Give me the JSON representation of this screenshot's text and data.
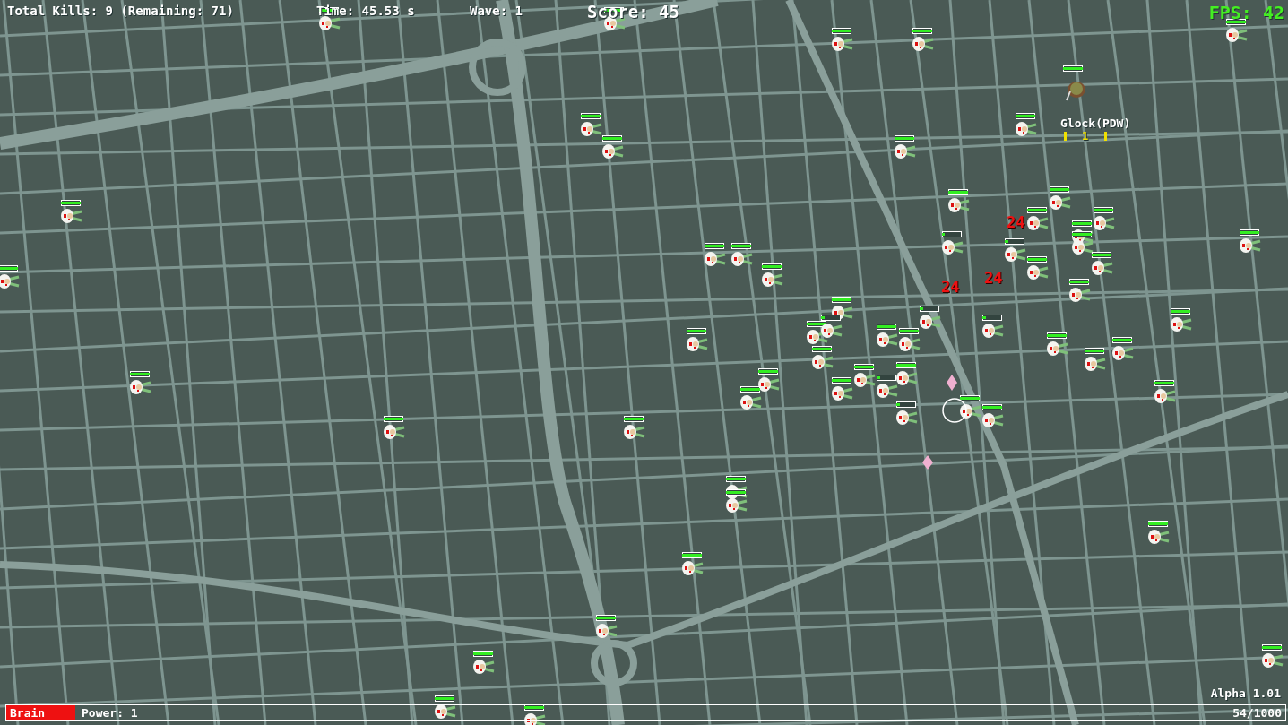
{
  "hud": {
    "kills": "Total Kills: 9 (Remaining: 71)",
    "time": "Time: 45.53 s",
    "wave": "Wave: 1",
    "score": "Score: 45",
    "fps": "FPS: 42",
    "version": "Alpha 1.01"
  },
  "player": {
    "level": 1,
    "weapon": "Glock(PDW)",
    "ammo": "1"
  },
  "damage_numbers": [
    "24",
    "24",
    "24"
  ],
  "zombies": [
    {
      "level": 1
    },
    {
      "level": 1
    },
    {
      "level": 1
    },
    {
      "level": 1
    },
    {
      "level": 1
    },
    {
      "level": 1
    },
    {
      "level": 1
    },
    {
      "level": 1
    },
    {
      "level": 1
    },
    {
      "level": 1
    },
    {
      "level": 1
    },
    {
      "level": 1
    },
    {
      "level": 1
    },
    {
      "level": 1
    },
    {
      "level": 1
    },
    {
      "level": 1
    },
    {
      "level": 0.2
    },
    {
      "level": 0.15
    },
    {
      "level": 1
    },
    {
      "level": 1
    },
    {
      "level": 1
    },
    {
      "level": 1
    },
    {
      "level": 1
    },
    {
      "level": 1
    },
    {
      "level": 1
    },
    {
      "level": 1
    },
    {
      "level": 1
    },
    {
      "level": 1
    },
    {
      "level": 0.2
    },
    {
      "level": 1
    },
    {
      "level": 0.2
    },
    {
      "level": 1
    },
    {
      "level": 1
    },
    {
      "level": 0.2
    },
    {
      "level": 1
    },
    {
      "level": 1
    },
    {
      "level": 1
    },
    {
      "level": 1
    },
    {
      "level": 1
    },
    {
      "level": 1
    },
    {
      "level": 0.2
    },
    {
      "level": 1
    },
    {
      "level": 1
    },
    {
      "level": 1
    },
    {
      "level": 1
    },
    {
      "level": 1
    },
    {
      "level": 1
    },
    {
      "level": 1
    },
    {
      "level": 1
    },
    {
      "level": 0.2
    },
    {
      "level": 1
    },
    {
      "level": 1
    },
    {
      "level": 1
    },
    {
      "level": 1
    },
    {
      "level": 1
    },
    {
      "level": 1
    },
    {
      "level": 1
    },
    {
      "level": 1
    },
    {
      "level": 1
    },
    {
      "level": 1
    },
    {
      "level": 1
    }
  ],
  "brain_power": {
    "label": "Brain",
    "power": "Power: 1",
    "reading": "54/1000",
    "level": 0.054
  }
}
